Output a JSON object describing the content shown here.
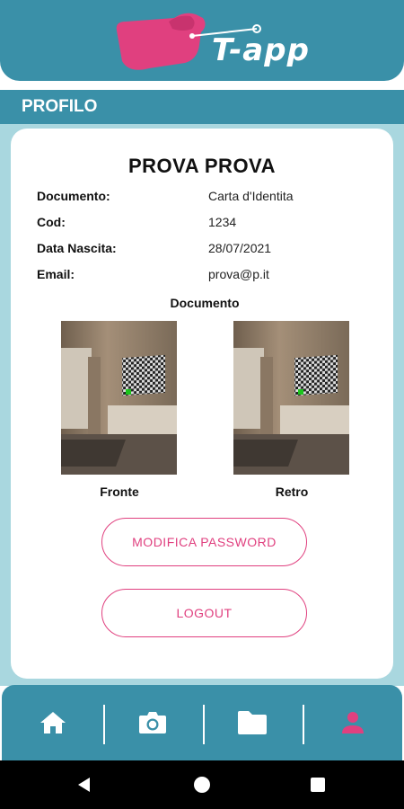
{
  "app": {
    "logo_text": "T-app",
    "brand_color": "#3a90a8",
    "accent_color": "#e0407f",
    "background_light": "#a9d7df"
  },
  "section": {
    "title": "PROFILO"
  },
  "profile": {
    "name": "PROVA PROVA",
    "fields": [
      {
        "label": "Documento:",
        "value": "Carta d'Identita"
      },
      {
        "label": "Cod:",
        "value": "1234"
      },
      {
        "label": "Data Nascita:",
        "value": "28/07/2021"
      },
      {
        "label": "Email:",
        "value": "prova@p.it"
      }
    ]
  },
  "documents": {
    "title": "Documento",
    "front_label": "Fronte",
    "back_label": "Retro"
  },
  "actions": {
    "change_password": "MODIFICA PASSWORD",
    "logout": "LOGOUT"
  },
  "bottom_nav": {
    "items": [
      {
        "icon": "home-icon",
        "active": false
      },
      {
        "icon": "camera-icon",
        "active": false
      },
      {
        "icon": "folder-icon",
        "active": false
      },
      {
        "icon": "person-icon",
        "active": true
      }
    ]
  },
  "system_nav": {
    "icons": [
      "back-icon",
      "home-circle-icon",
      "recents-icon"
    ]
  }
}
